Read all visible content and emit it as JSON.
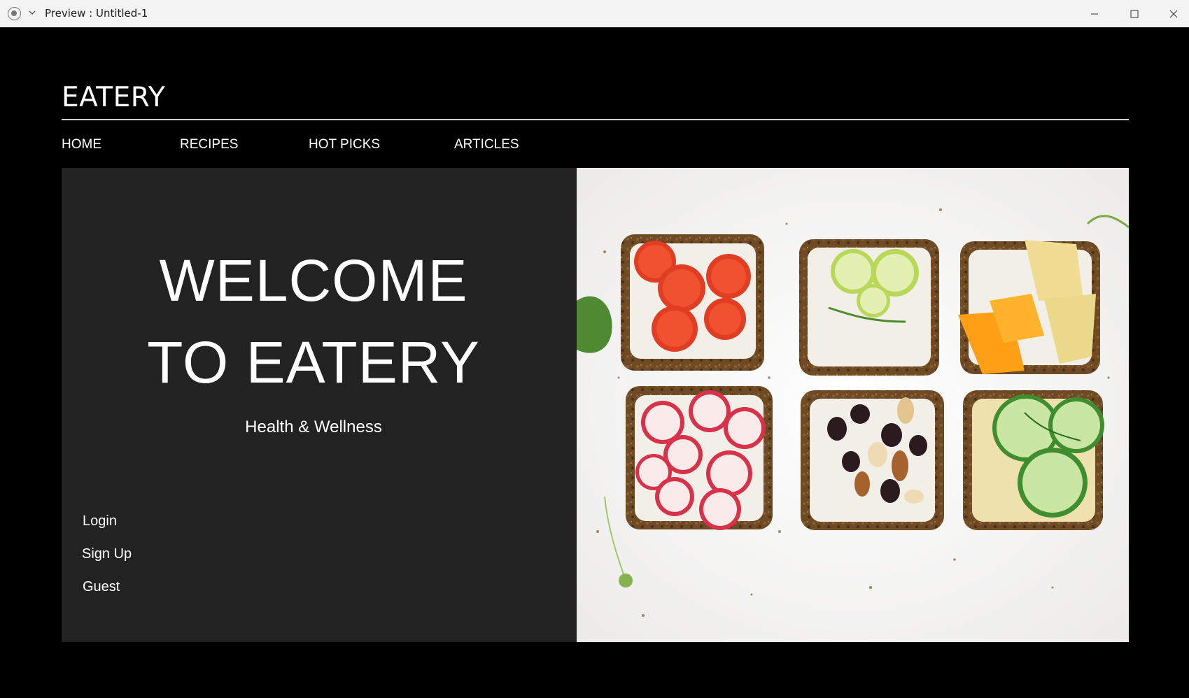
{
  "window": {
    "title": "Preview : Untitled-1"
  },
  "app": {
    "brand": "EATERY",
    "nav": [
      {
        "label": "HOME"
      },
      {
        "label": "RECIPES"
      },
      {
        "label": "HOT PICKS"
      },
      {
        "label": "ARTICLES"
      }
    ],
    "hero": {
      "line1": "WELCOME",
      "line2": "TO EATERY",
      "subtitle": "Health & Wellness"
    },
    "auth": {
      "login": "Login",
      "signup": "Sign Up",
      "guest": "Guest"
    }
  },
  "colors": {
    "canvas_bg": "#000000",
    "panel_bg": "#222222",
    "text": "#ffffff",
    "titlebar_bg": "#f3f3f3"
  },
  "icons": {
    "app": "app-record-icon",
    "chevron": "chevron-down-icon",
    "minimize": "minimize-icon",
    "maximize": "maximize-icon",
    "close": "close-icon"
  }
}
